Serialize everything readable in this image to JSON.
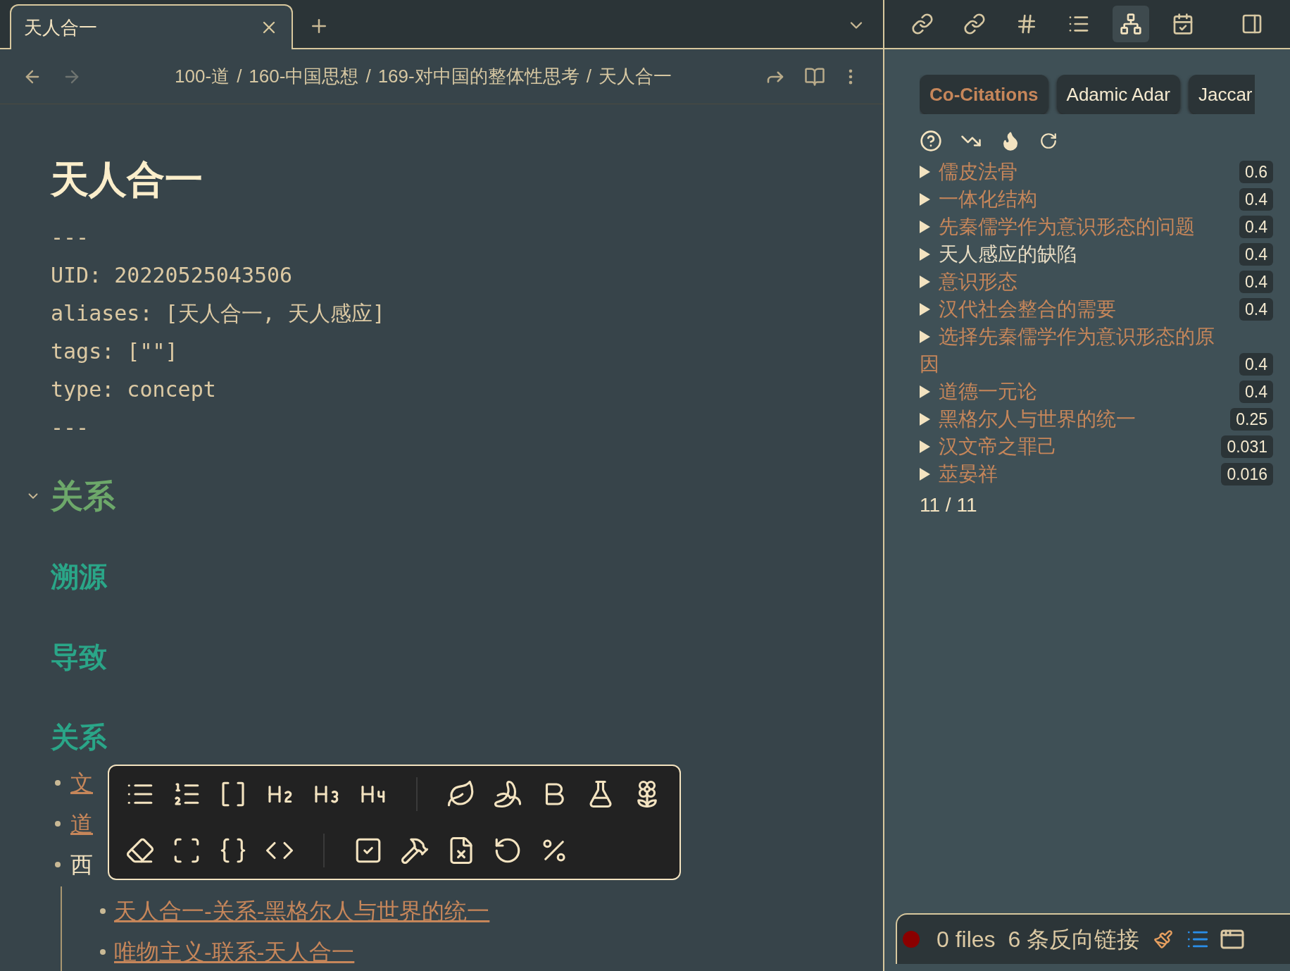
{
  "tabs": [
    {
      "label": "天人合一",
      "selected": true
    }
  ],
  "breadcrumb": {
    "parts": [
      "100-道",
      "160-中国思想",
      "169-对中国的整体性思考",
      "天人合一"
    ],
    "separator": "/"
  },
  "note": {
    "title": "天人合一",
    "frontmatter": [
      "---",
      "UID: 20220525043506",
      "aliases: [天人合一, 天人感应]",
      "tags: [\"\"]",
      "type: concept",
      "---"
    ],
    "blocks": [
      {
        "kind": "h2",
        "text": "关系",
        "expanded": true
      },
      {
        "kind": "h3",
        "text": "溯源"
      },
      {
        "kind": "h3",
        "text": "导致"
      },
      {
        "kind": "h3",
        "text": "关系"
      },
      {
        "kind": "list",
        "items": [
          {
            "text": "文",
            "link": true
          },
          {
            "text": "道",
            "link": true
          },
          {
            "text": "西",
            "link": false,
            "children": [
              {
                "text": "天人合一-关系-黑格尔人与世界的统一",
                "link": true
              },
              {
                "text": "唯物主义-联系-天人合一",
                "link": true
              }
            ]
          }
        ]
      }
    ]
  },
  "right_toolbar": [
    {
      "kind": "backlinks",
      "selected": false
    },
    {
      "kind": "outlinks",
      "selected": false
    },
    {
      "kind": "tags",
      "selected": false
    },
    {
      "kind": "outline",
      "selected": false
    },
    {
      "kind": "graph",
      "selected": true
    },
    {
      "kind": "calendar",
      "selected": false
    },
    {
      "kind": "sidebar",
      "selected": false
    }
  ],
  "similarity_panel": {
    "tabs": [
      {
        "label": "Co-Citations",
        "selected": true
      },
      {
        "label": "Adamic Adar",
        "selected": false
      },
      {
        "label": "Jaccar",
        "selected": false
      }
    ],
    "results": [
      {
        "name": "儒皮法骨",
        "score": "0.6",
        "current": false
      },
      {
        "name": "一体化结构",
        "score": "0.4",
        "current": false
      },
      {
        "name": "先秦儒学作为意识形态的问题",
        "score": "0.4",
        "current": false
      },
      {
        "name": "天人感应的缺陷",
        "score": "0.4",
        "current": true
      },
      {
        "name": "意识形态",
        "score": "0.4",
        "current": false
      },
      {
        "name": "汉代社会整合的需要",
        "score": "0.4",
        "current": false
      },
      {
        "name": "选择先秦儒学作为意识形态的原因",
        "score": "0.4",
        "current": false
      },
      {
        "name": "道德一元论",
        "score": "0.4",
        "current": false
      },
      {
        "name": "黑格尔人与世界的统一",
        "score": "0.25",
        "current": false
      },
      {
        "name": "汉文帝之罪己",
        "score": "0.031",
        "current": false
      },
      {
        "name": "莁晏祥",
        "score": "0.016",
        "current": false
      }
    ],
    "count": "11 / 11"
  },
  "status_bar": {
    "files": "0 files",
    "backlinks": "6 条反向链接"
  }
}
